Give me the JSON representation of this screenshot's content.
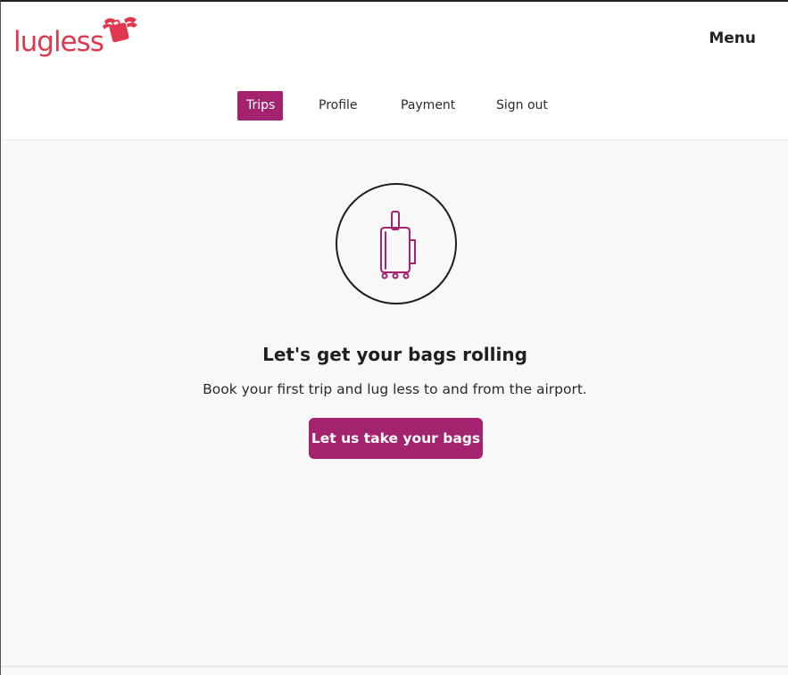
{
  "brand": {
    "name": "lugless",
    "color": "#e0394f"
  },
  "header": {
    "menu_label": "Menu"
  },
  "nav": {
    "items": [
      {
        "label": "Trips",
        "active": true
      },
      {
        "label": "Profile",
        "active": false
      },
      {
        "label": "Payment",
        "active": false
      },
      {
        "label": "Sign out",
        "active": false
      }
    ]
  },
  "empty_state": {
    "icon": "suitcase-icon",
    "heading": "Let's get your bags rolling",
    "subtext": "Book your first trip and lug less to and from the airport.",
    "cta_label": "Let us take your bags"
  },
  "colors": {
    "accent": "#a3236f",
    "background": "#f8f8f8",
    "header_bg": "#ffffff"
  }
}
